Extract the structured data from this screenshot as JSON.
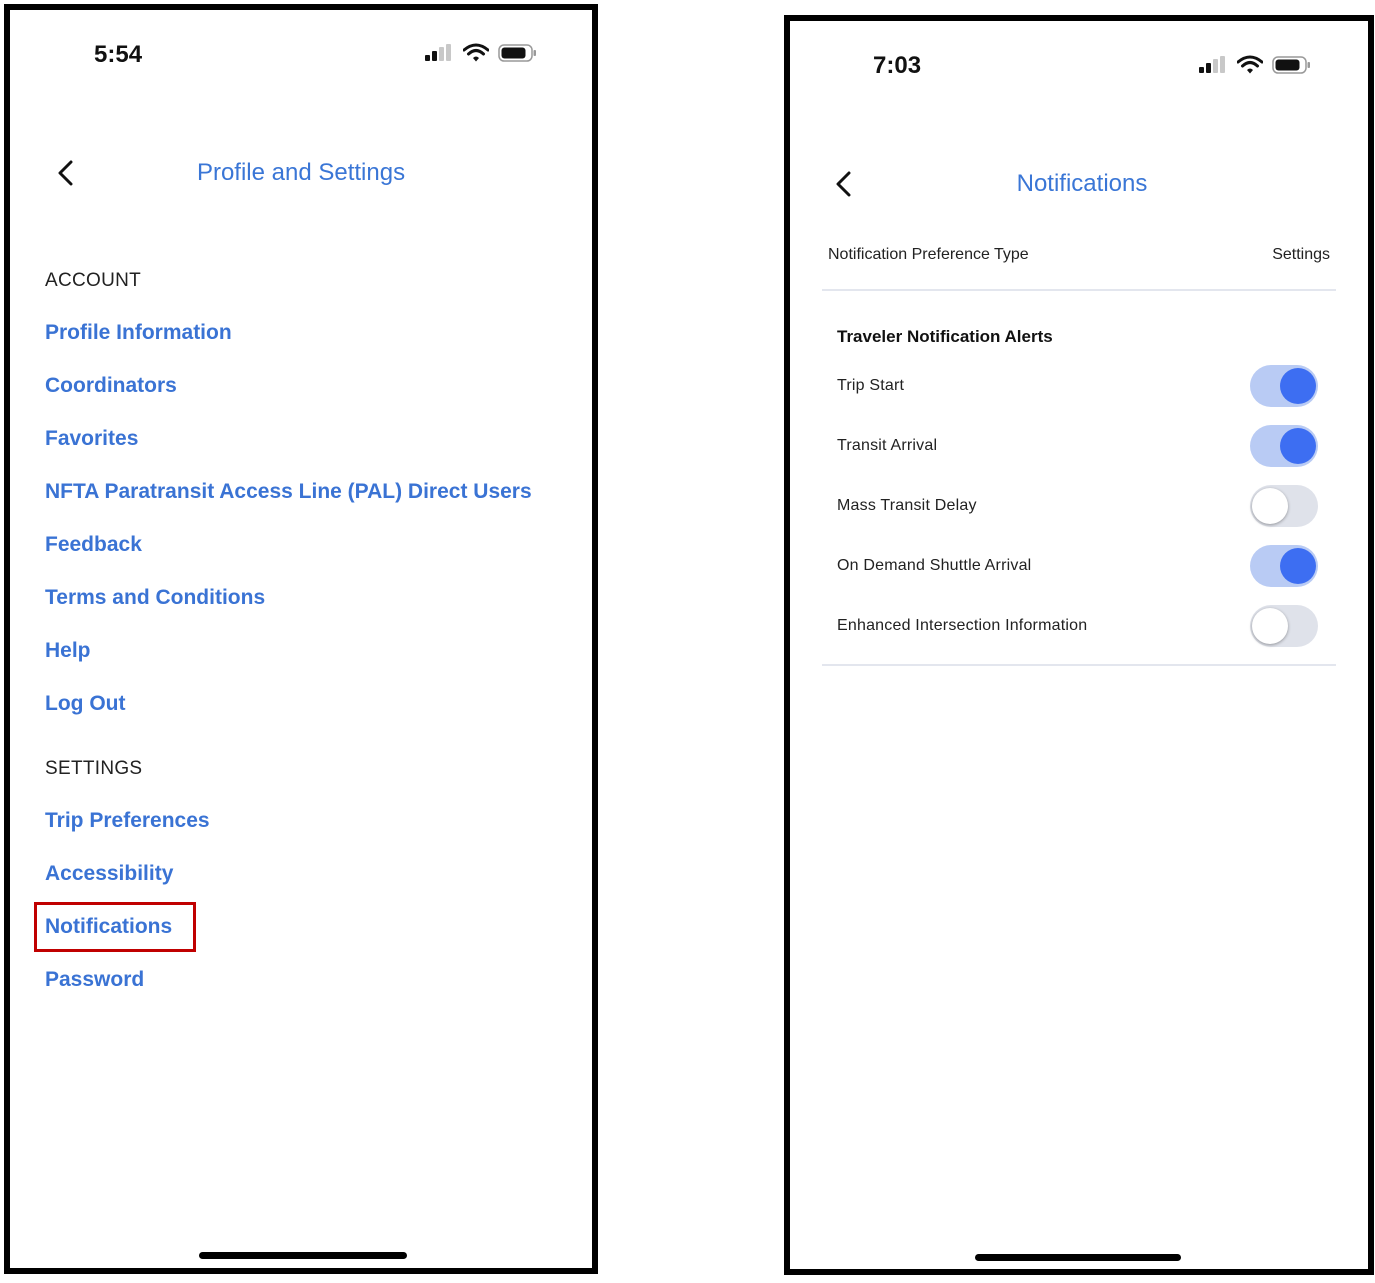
{
  "left_screen": {
    "status_bar": {
      "time": "5:54"
    },
    "nav": {
      "title": "Profile and Settings"
    },
    "account_header": "ACCOUNT",
    "account_items": [
      "Profile Information",
      "Coordinators",
      "Favorites",
      "NFTA Paratransit Access Line (PAL) Direct Users",
      "Feedback",
      "Terms and Conditions",
      "Help",
      "Log Out"
    ],
    "settings_header": "SETTINGS",
    "settings_items": [
      "Trip Preferences",
      "Accessibility",
      "Notifications",
      "Password"
    ],
    "highlighted_item": "Notifications",
    "highlight_color": "#c00000"
  },
  "right_screen": {
    "status_bar": {
      "time": "7:03"
    },
    "nav": {
      "title": "Notifications"
    },
    "table_header": {
      "type_label": "Notification Preference Type",
      "settings_label": "Settings"
    },
    "group_title": "Traveler Notification Alerts",
    "preferences": [
      {
        "label": "Trip Start",
        "enabled": true
      },
      {
        "label": "Transit Arrival",
        "enabled": true
      },
      {
        "label": "Mass Transit Delay",
        "enabled": false
      },
      {
        "label": "On Demand Shuttle Arrival",
        "enabled": true
      },
      {
        "label": "Enhanced Intersection Information",
        "enabled": false
      }
    ]
  },
  "colors": {
    "link_blue": "#3a73d4",
    "toggle_on_knob": "#3d6ef2",
    "toggle_on_track": "#b9cbf4",
    "toggle_off_track": "#dfe2ea"
  },
  "icons": [
    "signal-icon",
    "wifi-icon",
    "battery-icon",
    "back-chevron-icon",
    "home-indicator"
  ]
}
